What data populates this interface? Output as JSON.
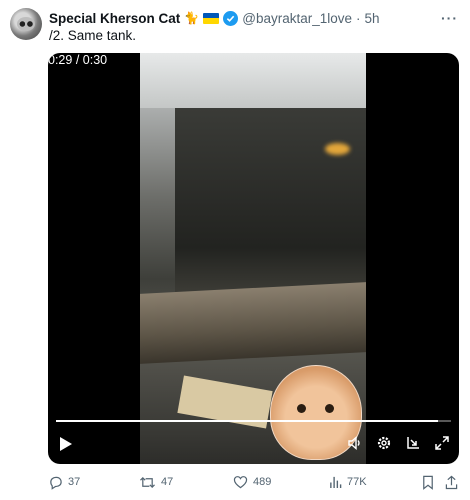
{
  "post": {
    "author_name": "Special Kherson Cat",
    "author_emoji": "🐈",
    "handle": "@bayraktar_1love",
    "separator": "·",
    "time": "5h",
    "text": "/2. Same tank.",
    "more_label": "···"
  },
  "video": {
    "current_time": "0:29",
    "time_separator": " / ",
    "duration": "0:30",
    "progress_fraction": 0.967
  },
  "actions": {
    "replies": "37",
    "reposts": "47",
    "likes": "489",
    "views": "77K"
  },
  "colors": {
    "accent": "#1d9bf0",
    "muted": "#536471",
    "flag_blue": "#0057b7",
    "flag_yellow": "#ffd700"
  },
  "icons": [
    "more-icon",
    "verified-icon",
    "play-icon",
    "volume-icon",
    "settings-icon",
    "pip-icon",
    "fullscreen-icon",
    "reply-icon",
    "repost-icon",
    "like-icon",
    "views-icon",
    "bookmark-icon",
    "share-icon"
  ]
}
